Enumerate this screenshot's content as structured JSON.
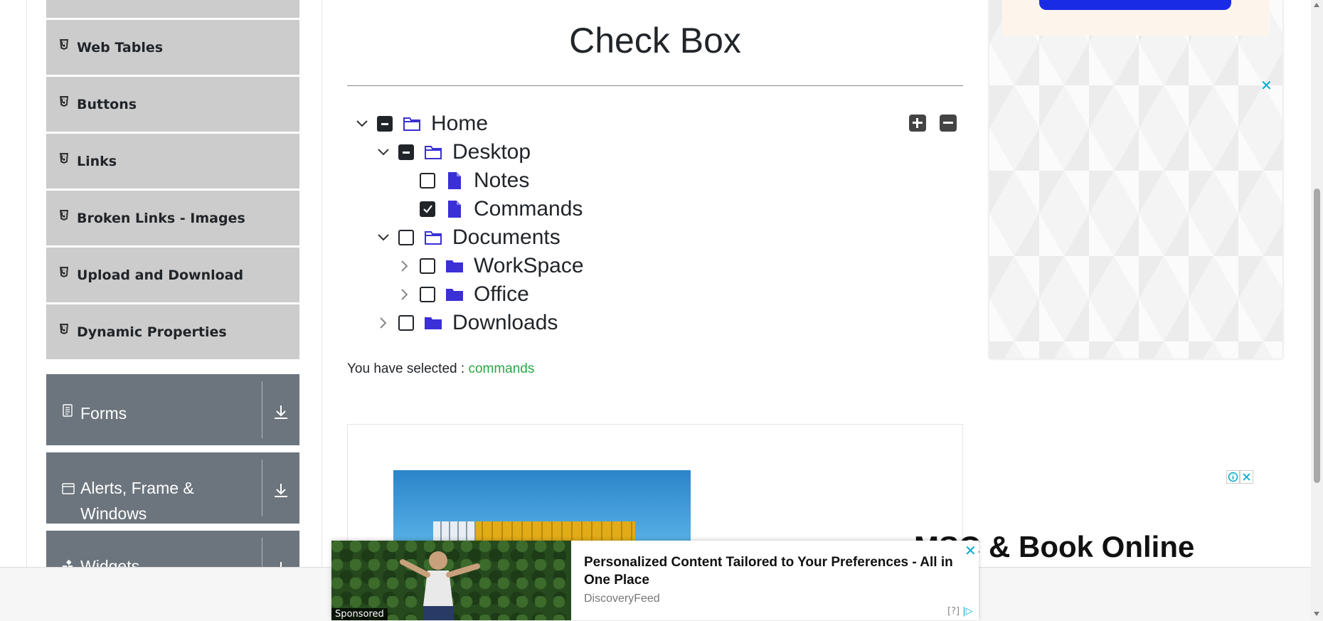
{
  "sidebar": {
    "elements_items": [
      {
        "label": "Web Tables"
      },
      {
        "label": "Buttons"
      },
      {
        "label": "Links"
      },
      {
        "label": "Broken Links - Images"
      },
      {
        "label": "Upload and Download"
      },
      {
        "label": "Dynamic Properties"
      }
    ],
    "groups": [
      {
        "label": "Forms"
      },
      {
        "label": "Alerts, Frame & Windows"
      },
      {
        "label": "Widgets"
      }
    ]
  },
  "main": {
    "title": "Check Box",
    "tree": [
      {
        "label": "Home",
        "level": 0,
        "expanded": true,
        "state": "half",
        "type": "folder-open"
      },
      {
        "label": "Desktop",
        "level": 1,
        "expanded": true,
        "state": "half",
        "type": "folder-open"
      },
      {
        "label": "Notes",
        "level": 2,
        "state": "unchecked",
        "type": "file"
      },
      {
        "label": "Commands",
        "level": 2,
        "state": "checked",
        "type": "file"
      },
      {
        "label": "Documents",
        "level": 1,
        "expanded": true,
        "state": "unchecked",
        "type": "folder-open"
      },
      {
        "label": "WorkSpace",
        "level": 2,
        "expanded": false,
        "state": "unchecked",
        "type": "folder"
      },
      {
        "label": "Office",
        "level": 2,
        "expanded": false,
        "state": "unchecked",
        "type": "folder"
      },
      {
        "label": "Downloads",
        "level": 1,
        "expanded": false,
        "state": "unchecked",
        "type": "folder"
      }
    ],
    "result_prefix": "You have selected :",
    "result_value": "commands"
  },
  "ads": {
    "mid_headline": "MSC & Book Online",
    "popup": {
      "title": "Personalized Content Tailored to Your Preferences - All in One Place",
      "source": "DiscoveryFeed",
      "sponsored": "Sponsored",
      "help": "[?]"
    }
  },
  "colors": {
    "sidebar_item_bg": "#cccccc",
    "group_bg": "#6c757d",
    "folder_icon": "#3b2fd6",
    "result_value": "#28a745",
    "ad_close": "#00aacc"
  }
}
